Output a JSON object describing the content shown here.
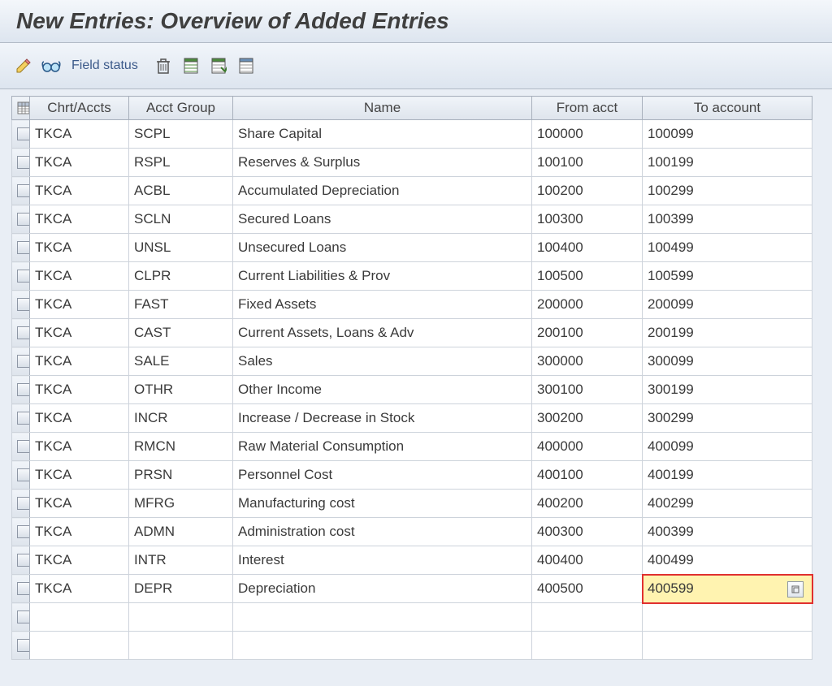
{
  "title": "New Entries: Overview of Added Entries",
  "toolbar": {
    "field_status_label": "Field status"
  },
  "columns": {
    "chart": "Chrt/Accts",
    "group": "Acct Group",
    "name": "Name",
    "from": "From acct",
    "to": "To account"
  },
  "rows": [
    {
      "chart": "TKCA",
      "group": "SCPL",
      "name": "Share Capital",
      "from": "100000",
      "to": "100099"
    },
    {
      "chart": "TKCA",
      "group": "RSPL",
      "name": "Reserves & Surplus",
      "from": "100100",
      "to": "100199"
    },
    {
      "chart": "TKCA",
      "group": "ACBL",
      "name": "Accumulated Depreciation",
      "from": "100200",
      "to": "100299"
    },
    {
      "chart": "TKCA",
      "group": "SCLN",
      "name": "Secured Loans",
      "from": "100300",
      "to": "100399"
    },
    {
      "chart": "TKCA",
      "group": "UNSL",
      "name": "Unsecured Loans",
      "from": "100400",
      "to": "100499"
    },
    {
      "chart": "TKCA",
      "group": "CLPR",
      "name": "Current Liabilities & Prov",
      "from": "100500",
      "to": "100599"
    },
    {
      "chart": "TKCA",
      "group": "FAST",
      "name": "Fixed Assets",
      "from": "200000",
      "to": "200099"
    },
    {
      "chart": "TKCA",
      "group": "CAST",
      "name": "Current Assets, Loans & Adv",
      "from": "200100",
      "to": "200199"
    },
    {
      "chart": "TKCA",
      "group": "SALE",
      "name": "Sales",
      "from": "300000",
      "to": "300099"
    },
    {
      "chart": "TKCA",
      "group": "OTHR",
      "name": "Other Income",
      "from": "300100",
      "to": "300199"
    },
    {
      "chart": "TKCA",
      "group": "INCR",
      "name": "Increase / Decrease in Stock",
      "from": "300200",
      "to": "300299"
    },
    {
      "chart": "TKCA",
      "group": "RMCN",
      "name": "Raw Material Consumption",
      "from": "400000",
      "to": "400099"
    },
    {
      "chart": "TKCA",
      "group": "PRSN",
      "name": "Personnel Cost",
      "from": "400100",
      "to": "400199"
    },
    {
      "chart": "TKCA",
      "group": "MFRG",
      "name": "Manufacturing cost",
      "from": "400200",
      "to": "400299"
    },
    {
      "chart": "TKCA",
      "group": "ADMN",
      "name": "Administration cost",
      "from": "400300",
      "to": "400399"
    },
    {
      "chart": "TKCA",
      "group": "INTR",
      "name": "Interest",
      "from": "400400",
      "to": "400499"
    },
    {
      "chart": "TKCA",
      "group": "DEPR",
      "name": "Depreciation",
      "from": "400500",
      "to": "400599"
    }
  ],
  "active_cell": {
    "row": 16,
    "field": "to"
  },
  "icons": {
    "edit": "edit-icon",
    "glasses": "glasses-icon",
    "trash": "trash-icon",
    "select_all": "select-all-icon",
    "select_block": "select-block-icon",
    "deselect_all": "deselect-all-icon",
    "table_settings": "table-settings-icon",
    "f4": "search-help-icon"
  }
}
